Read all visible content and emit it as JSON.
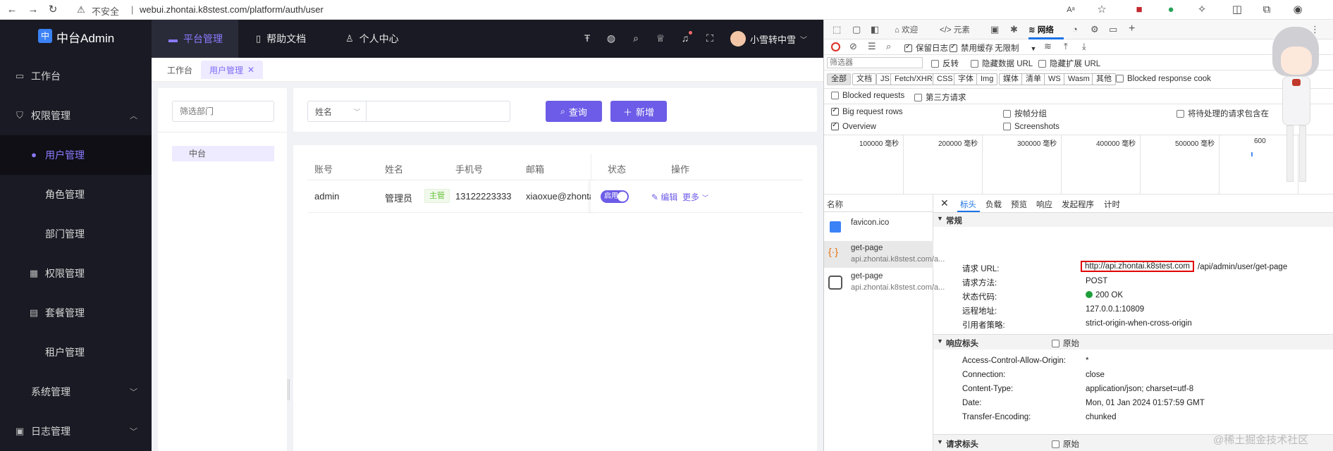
{
  "browser": {
    "insecure_label": "不安全",
    "url": "webui.zhontai.k8stest.com/platform/auth/user"
  },
  "app": {
    "logo_text": "中台Admin",
    "logo_mark": "中",
    "sidebar": [
      {
        "label": "工作台",
        "icon": "monitor-icon"
      },
      {
        "label": "权限管理",
        "icon": "shield-icon",
        "expanded": true
      },
      {
        "label": "用户管理",
        "icon": "user-icon",
        "active": true
      },
      {
        "label": "角色管理"
      },
      {
        "label": "部门管理"
      },
      {
        "label": "权限管理",
        "icon": "grid-icon"
      },
      {
        "label": "套餐管理",
        "icon": "list-icon"
      },
      {
        "label": "租户管理"
      },
      {
        "label": "系统管理"
      },
      {
        "label": "日志管理"
      }
    ],
    "topnav": [
      {
        "label": "平台管理",
        "icon": "monitor-icon"
      },
      {
        "label": "帮助文档",
        "icon": "book-icon"
      },
      {
        "label": "个人中心",
        "icon": "user-icon"
      }
    ],
    "user_name": "小雪转中雪",
    "tabs": [
      {
        "label": "工作台"
      },
      {
        "label": "用户管理"
      }
    ],
    "dept_filter_placeholder": "筛选部门",
    "dept_tree": [
      "中台"
    ],
    "search_field_select": "姓名",
    "search_btn": "查询",
    "add_btn": "新增",
    "table": {
      "headers": [
        "账号",
        "姓名",
        "手机号",
        "邮箱",
        "状态",
        "操作"
      ],
      "rows": [
        {
          "account": "admin",
          "name": "管理员",
          "tag": "主管",
          "phone": "13122223333",
          "email": "xiaoxue@zhontai.",
          "status": "启用",
          "edit": "编辑",
          "more": "更多"
        }
      ]
    }
  },
  "devtools": {
    "tabs": [
      "欢迎",
      "元素",
      "网络"
    ],
    "network_bar": {
      "preserve_log": "保留日志",
      "disable_cache": "禁用缓存",
      "throttle": "无限制"
    },
    "filter_placeholder": "筛选器",
    "opts": [
      "反转",
      "隐藏数据 URL",
      "隐藏扩展 URL"
    ],
    "type_chips": [
      "全部",
      "文档",
      "JS",
      "Fetch/XHR",
      "CSS",
      "字体",
      "Img",
      "媒体",
      "清单",
      "WS",
      "Wasm",
      "其他"
    ],
    "blocked_cookies": "Blocked response cook",
    "blocked_requests": "Blocked requests",
    "third_party": "第三方请求",
    "big_rows": "Big request rows",
    "group_frame": "按帧分组",
    "pending": "将待处理的请求包含在",
    "overview": "Overview",
    "screenshots": "Screenshots",
    "timeline_ticks": [
      "100000 毫秒",
      "200000 毫秒",
      "300000 毫秒",
      "400000 毫秒",
      "500000 毫秒",
      "600"
    ],
    "name_header": "名称",
    "requests": [
      {
        "name": "favicon.ico",
        "domain": ""
      },
      {
        "name": "get-page",
        "domain": "api.zhontai.k8stest.com/a..."
      },
      {
        "name": "get-page",
        "domain": "api.zhontai.k8stest.com/a..."
      }
    ],
    "detail_tabs": [
      "标头",
      "负载",
      "预览",
      "响应",
      "发起程序",
      "计时"
    ],
    "general_title": "常规",
    "general": [
      {
        "k": "请求 URL:",
        "v_host": "http://api.zhontai.k8stest.com",
        "v_path": "/api/admin/user/get-page"
      },
      {
        "k": "请求方法:",
        "v": "POST"
      },
      {
        "k": "状态代码:",
        "v": "200 OK"
      },
      {
        "k": "远程地址:",
        "v": "127.0.0.1:10809"
      },
      {
        "k": "引用者策略:",
        "v": "strict-origin-when-cross-origin"
      }
    ],
    "resp_title": "响应标头",
    "raw_label": "原始",
    "resp_headers": [
      {
        "k": "Access-Control-Allow-Origin:",
        "v": "*"
      },
      {
        "k": "Connection:",
        "v": "close"
      },
      {
        "k": "Content-Type:",
        "v": "application/json; charset=utf-8"
      },
      {
        "k": "Date:",
        "v": "Mon, 01 Jan 2024 01:57:59 GMT"
      },
      {
        "k": "Transfer-Encoding:",
        "v": "chunked"
      }
    ],
    "req_title": "请求标头",
    "watermark": "@稀土掘金技术社区",
    "colors": {
      "accent": "#6c5ce7",
      "highlight_box": "#e00000",
      "status_ok": "#1e9e3a"
    }
  }
}
